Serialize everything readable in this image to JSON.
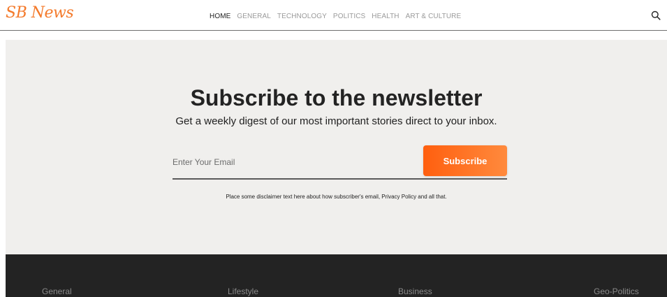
{
  "header": {
    "logo_text": "SB News",
    "nav": [
      {
        "label": "HOME",
        "active": true
      },
      {
        "label": "GENERAL",
        "active": false
      },
      {
        "label": "TECHNOLOGY",
        "active": false
      },
      {
        "label": "POLITICS",
        "active": false
      },
      {
        "label": "HEALTH",
        "active": false
      },
      {
        "label": "ART & CULTURE",
        "active": false
      }
    ],
    "search_icon": "search-icon"
  },
  "newsletter": {
    "title": "Subscribe to the newsletter",
    "subtitle": "Get a weekly digest of our most important stories direct to your inbox.",
    "email_placeholder": "Enter Your Email",
    "email_value": "",
    "subscribe_label": "Subscribe",
    "disclaimer": "Place some disclaimer text here about how subscriber's email, Privacy Policy and all that."
  },
  "footer": {
    "links": [
      "General",
      "Lifestyle",
      "Business",
      "Geo-Politics"
    ]
  },
  "colors": {
    "brand_orange": "#f47a2b",
    "button_gradient_start": "#ff5f0f",
    "button_gradient_end": "#ff8a3d",
    "newsletter_bg": "#f0efed",
    "footer_bg": "#232323"
  }
}
